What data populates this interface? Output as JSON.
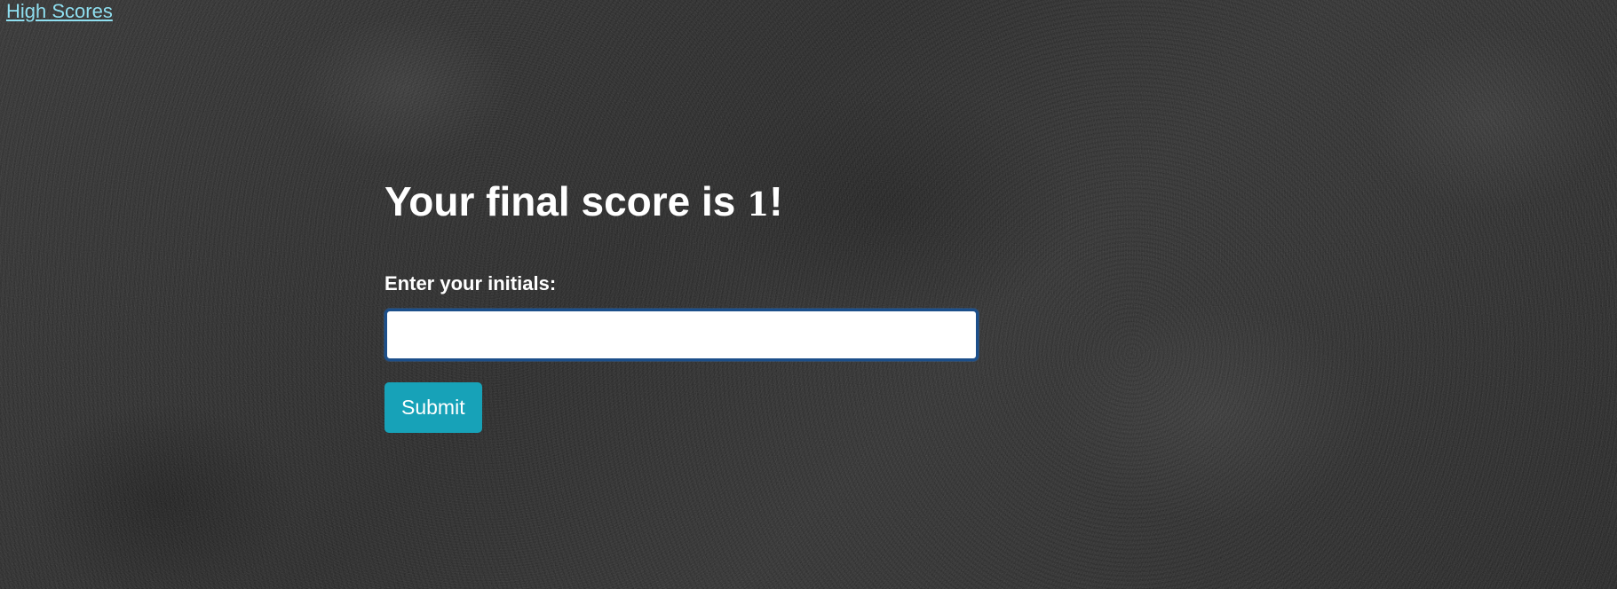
{
  "nav": {
    "high_scores_label": "High Scores"
  },
  "result": {
    "final_score_prefix": "Your final score is ",
    "score": "1",
    "final_score_suffix": "!"
  },
  "form": {
    "initials_label": "Enter your initials:",
    "initials_value": "",
    "initials_placeholder": "",
    "submit_label": "Submit"
  },
  "colors": {
    "link": "#8fdff0",
    "button_bg": "#17a2b8",
    "input_border_focus": "#1c4f8a",
    "text": "#ffffff"
  }
}
